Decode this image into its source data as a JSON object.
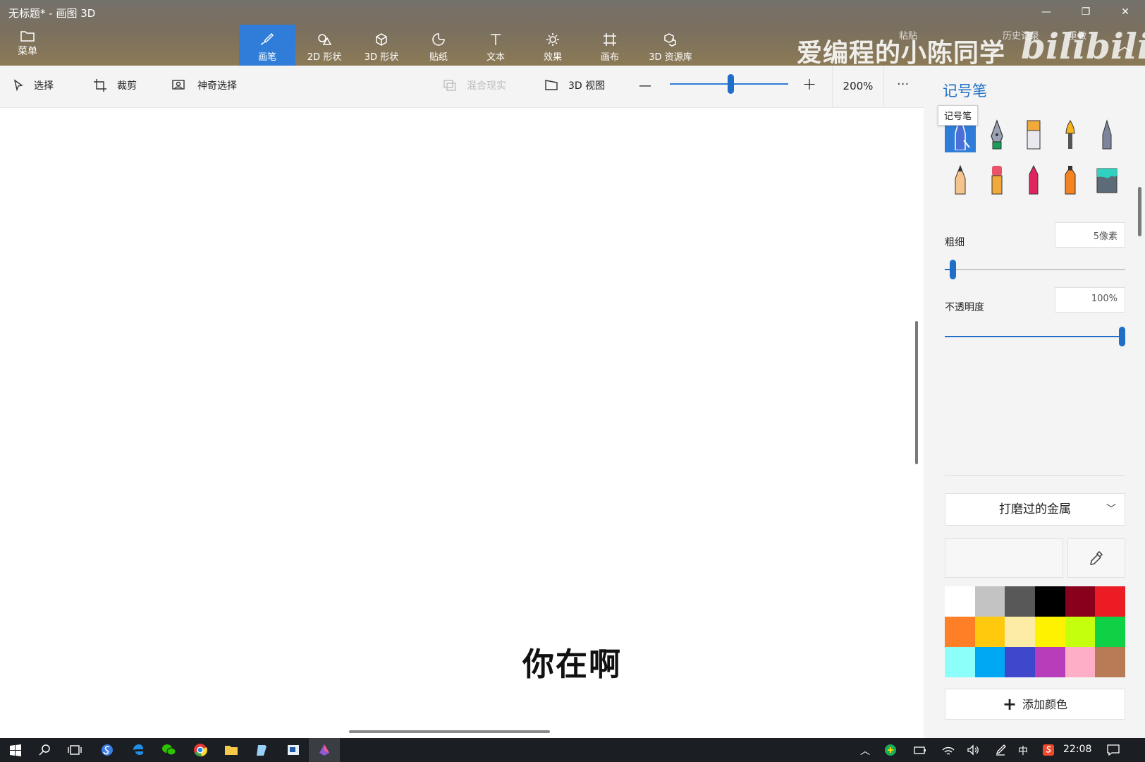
{
  "window": {
    "title": "无标题* - 画图 3D",
    "minimize": "—",
    "restore": "❐",
    "close": "✕"
  },
  "ribbon": {
    "menu_label": "菜单",
    "tabs": [
      {
        "label": "画笔",
        "icon": "brush-icon"
      },
      {
        "label": "2D 形状",
        "icon": "shapes-2d-icon"
      },
      {
        "label": "3D 形状",
        "icon": "cube-icon"
      },
      {
        "label": "贴纸",
        "icon": "sticker-icon"
      },
      {
        "label": "文本",
        "icon": "text-icon"
      },
      {
        "label": "效果",
        "icon": "effects-icon"
      },
      {
        "label": "画布",
        "icon": "canvas-icon"
      },
      {
        "label": "3D 资源库",
        "icon": "library-icon"
      }
    ],
    "active_tab": "画笔",
    "right_items": [
      "粘贴",
      "历史记录",
      "重做"
    ],
    "watermark": "爱编程的小陈同学",
    "watermark_logo": "bilibili"
  },
  "subtoolbar": {
    "select": "选择",
    "crop": "裁剪",
    "magic_select": "神奇选择",
    "mixed_reality": "混合现实",
    "view_3d": "3D 视图",
    "zoom_minus": "—",
    "zoom_plus": "+",
    "zoom_value": "200%",
    "zoom_fraction": 0.5,
    "more": "···"
  },
  "canvas": {
    "subtitle": "你在啊"
  },
  "panel": {
    "title": "记号笔",
    "tooltip": "记号笔",
    "brushes": [
      "marker-icon",
      "calligraphy-pen-icon",
      "oil-brush-icon",
      "watercolor-icon",
      "pixel-pen-icon",
      "pencil-icon",
      "eraser-icon",
      "crayon-icon",
      "spray-can-icon",
      "fill-bucket-icon"
    ],
    "selected_brush": 0,
    "thickness_label": "粗细",
    "thickness_value": "5像素",
    "thickness_fraction": 0.03,
    "opacity_label": "不透明度",
    "opacity_value": "100%",
    "opacity_fraction": 1.0,
    "material": "打磨过的金属",
    "palette": [
      "#ffffff",
      "#c3c3c3",
      "#585858",
      "#000000",
      "#88001b",
      "#ec1c24",
      "#ff7f27",
      "#ffc90e",
      "#fdeca6",
      "#fff200",
      "#c4ff0e",
      "#0ed145",
      "#8cfffb",
      "#00a8f3",
      "#3f48cc",
      "#b83dba",
      "#ffaec8",
      "#b97a56"
    ],
    "add_color": "添加颜色",
    "accent": "#1f6fc8"
  },
  "taskbar": {
    "time": "22:08",
    "ime": "中",
    "icons": [
      "windows-start-icon",
      "search-icon",
      "task-view-icon",
      "sogou-icon",
      "edge-icon",
      "wechat-icon",
      "chrome-icon",
      "file-explorer-icon",
      "notepad-icon",
      "app-icon",
      "paint-3d-icon"
    ]
  }
}
